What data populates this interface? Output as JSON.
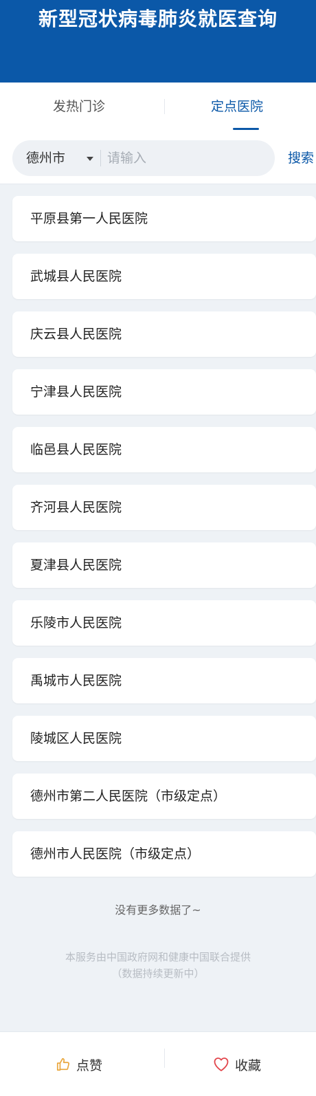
{
  "header": {
    "title": "新型冠状病毒肺炎就医查询"
  },
  "tabs": [
    {
      "label": "发热门诊",
      "active": false
    },
    {
      "label": "定点医院",
      "active": true
    }
  ],
  "search": {
    "city": "德州市",
    "placeholder": "请输入",
    "value": "",
    "button_label": "搜索"
  },
  "hospitals": [
    "平原县第一人民医院",
    "武城县人民医院",
    "庆云县人民医院",
    "宁津县人民医院",
    "临邑县人民医院",
    "齐河县人民医院",
    "夏津县人民医院",
    "乐陵市人民医院",
    "禹城市人民医院",
    "陵城区人民医院",
    "德州市第二人民医院（市级定点）",
    "德州市人民医院（市级定点）"
  ],
  "no_more_text": "没有更多数据了~",
  "footer": {
    "line1": "本服务由中国政府网和健康中国联合提供",
    "line2": "（数据持续更新中）"
  },
  "bottom_bar": {
    "like_label": "点赞",
    "like_icon": "thumbs-up-icon",
    "favorite_label": "收藏",
    "favorite_icon": "heart-icon"
  },
  "colors": {
    "brand_blue": "#0b58a8",
    "background": "#eef2f6",
    "like_icon": "#e9a53a",
    "favorite_icon": "#e2454b"
  }
}
